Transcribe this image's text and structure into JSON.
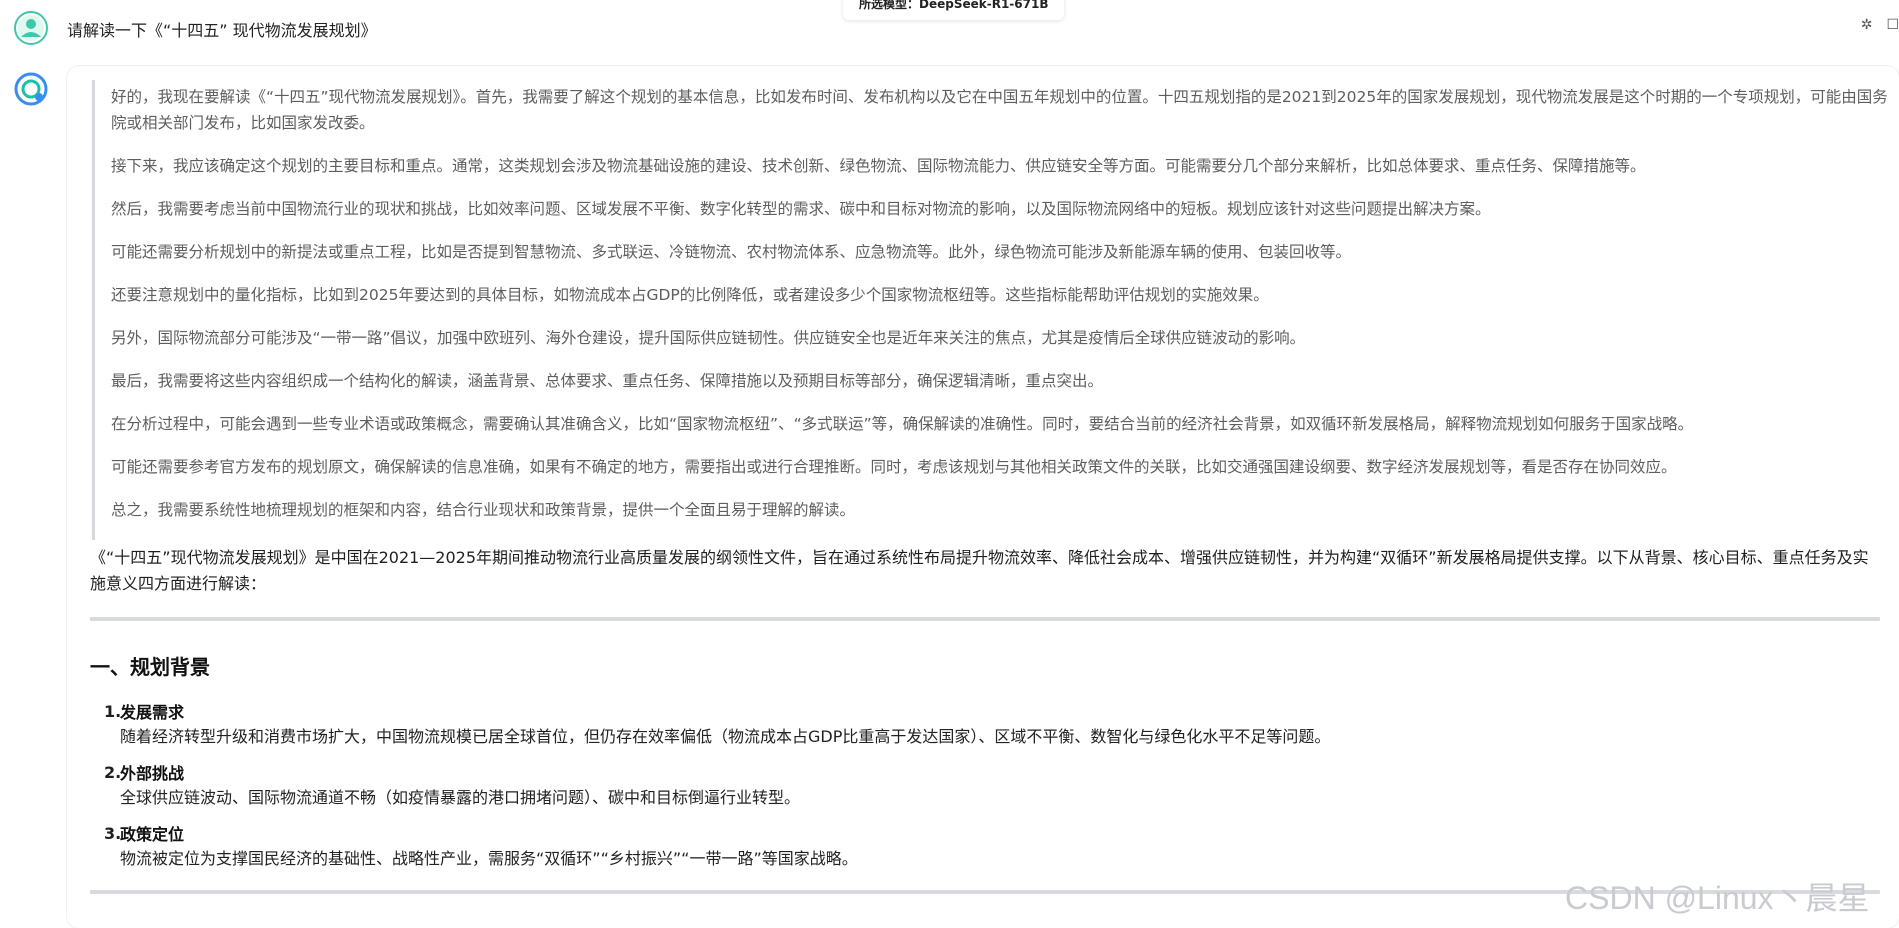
{
  "header": {
    "model_tag": "所选模型：DeepSeek-R1-671B",
    "user_question": "请解读一下《“十四五” 现代物流发展规划》",
    "right_icons": [
      "sparkle-icon",
      "edit-icon"
    ]
  },
  "thinking": [
    "好的，我现在要解读《“十四五”现代物流发展规划》。首先，我需要了解这个规划的基本信息，比如发布时间、发布机构以及它在中国五年规划中的位置。十四五规划指的是2021到2025年的国家发展规划，现代物流发展是这个时期的一个专项规划，可能由国务院或相关部门发布，比如国家发改委。",
    "接下来，我应该确定这个规划的主要目标和重点。通常，这类规划会涉及物流基础设施的建设、技术创新、绿色物流、国际物流能力、供应链安全等方面。可能需要分几个部分来解析，比如总体要求、重点任务、保障措施等。",
    "然后，我需要考虑当前中国物流行业的现状和挑战，比如效率问题、区域发展不平衡、数字化转型的需求、碳中和目标对物流的影响，以及国际物流网络中的短板。规划应该针对这些问题提出解决方案。",
    "可能还需要分析规划中的新提法或重点工程，比如是否提到智慧物流、多式联运、冷链物流、农村物流体系、应急物流等。此外，绿色物流可能涉及新能源车辆的使用、包装回收等。",
    "还要注意规划中的量化指标，比如到2025年要达到的具体目标，如物流成本占GDP的比例降低，或者建设多少个国家物流枢纽等。这些指标能帮助评估规划的实施效果。",
    "另外，国际物流部分可能涉及“一带一路”倡议，加强中欧班列、海外仓建设，提升国际供应链韧性。供应链安全也是近年来关注的焦点，尤其是疫情后全球供应链波动的影响。",
    "最后，我需要将这些内容组织成一个结构化的解读，涵盖背景、总体要求、重点任务、保障措施以及预期目标等部分，确保逻辑清晰，重点突出。",
    "在分析过程中，可能会遇到一些专业术语或政策概念，需要确认其准确含义，比如“国家物流枢纽”、“多式联运”等，确保解读的准确性。同时，要结合当前的经济社会背景，如双循环新发展格局，解释物流规划如何服务于国家战略。",
    "可能还需要参考官方发布的规划原文，确保解读的信息准确，如果有不确定的地方，需要指出或进行合理推断。同时，考虑该规划与其他相关政策文件的关联，比如交通强国建设纲要、数字经济发展规划等，看是否存在协同效应。",
    "总之，我需要系统性地梳理规划的框架和内容，结合行业现状和政策背景，提供一个全面且易于理解的解读。"
  ],
  "answer": {
    "intro": "《“十四五”现代物流发展规划》是中国在2021—2025年期间推动物流行业高质量发展的纲领性文件，旨在通过系统性布局提升物流效率、降低社会成本、增强供应链韧性，并为构建“双循环”新发展格局提供支撑。以下从背景、核心目标、重点任务及实施意义四方面进行解读：",
    "section_title": "一、规划背景",
    "items": [
      {
        "num": "1.",
        "title": "发展需求",
        "desc": "随着经济转型升级和消费市场扩大，中国物流规模已居全球首位，但仍存在效率偏低（物流成本占GDP比重高于发达国家）、区域不平衡、数智化与绿色化水平不足等问题。"
      },
      {
        "num": "2.",
        "title": "外部挑战",
        "desc": "全球供应链波动、国际物流通道不畅（如疫情暴露的港口拥堵问题）、碳中和目标倒逼行业转型。"
      },
      {
        "num": "3.",
        "title": "政策定位",
        "desc": "物流被定位为支撑国民经济的基础性、战略性产业，需服务“双循环”“乡村振兴”“一带一路”等国家战略。"
      }
    ]
  },
  "watermark": "CSDN @Linux丶晨星"
}
